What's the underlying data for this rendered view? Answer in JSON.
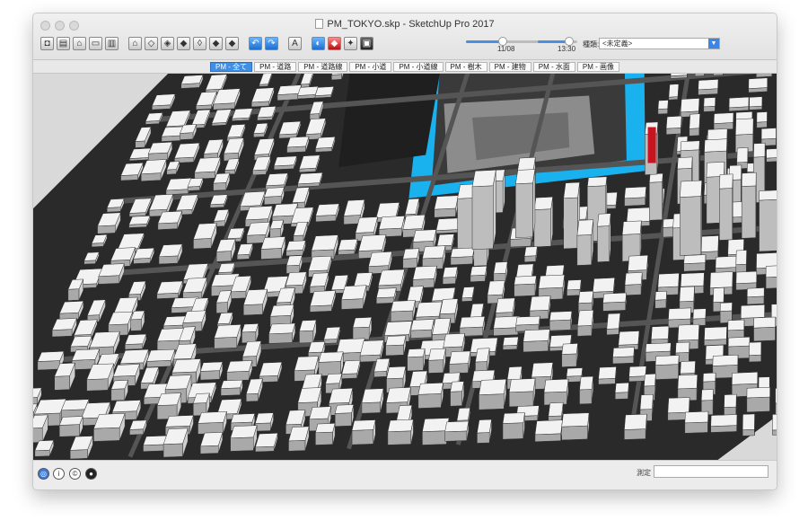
{
  "window": {
    "title": "PM_TOKYO.skp - SketchUp Pro 2017"
  },
  "toolbar": {
    "tools": [
      {
        "icon": "camera-icon",
        "glyph": "◘"
      },
      {
        "icon": "book-icon",
        "glyph": "▤"
      },
      {
        "icon": "home-icon",
        "glyph": "⌂"
      },
      {
        "icon": "save-icon",
        "glyph": "▭"
      },
      {
        "icon": "print-icon",
        "glyph": "▥"
      },
      {
        "icon": "house-view-icon",
        "glyph": "⌂"
      },
      {
        "icon": "iso-view-icon",
        "glyph": "◇"
      },
      {
        "icon": "top-view-icon",
        "glyph": "◈"
      },
      {
        "icon": "front-view-icon",
        "glyph": "◆"
      },
      {
        "icon": "right-view-icon",
        "glyph": "◊"
      },
      {
        "icon": "back-view-icon",
        "glyph": "◆"
      },
      {
        "icon": "left-view-icon",
        "glyph": "◆"
      },
      {
        "icon": "undo-icon",
        "glyph": "↶"
      },
      {
        "icon": "redo-icon",
        "glyph": "↷"
      },
      {
        "icon": "text-icon",
        "glyph": "A"
      },
      {
        "icon": "shadow-icon",
        "glyph": "◐"
      },
      {
        "icon": "ruby-icon",
        "glyph": "◆"
      },
      {
        "icon": "extension-icon",
        "glyph": "✦"
      },
      {
        "icon": "layout-icon",
        "glyph": "▣"
      }
    ],
    "date_label": "11/08",
    "date_fraction": 0.45,
    "time_label": "13:30",
    "time_fraction": 0.8,
    "scene_label": "種類:",
    "scene_value": "<未定義>"
  },
  "scene_tabs": [
    {
      "label": "PM - 全て",
      "active": true
    },
    {
      "label": "PM - 道路",
      "active": false
    },
    {
      "label": "PM - 道路線",
      "active": false
    },
    {
      "label": "PM - 小道",
      "active": false
    },
    {
      "label": "PM - 小道線",
      "active": false
    },
    {
      "label": "PM - 樹木",
      "active": false
    },
    {
      "label": "PM - 建物",
      "active": false
    },
    {
      "label": "PM - 水面",
      "active": false
    },
    {
      "label": "PM - 画像",
      "active": false
    }
  ],
  "statusbar": {
    "measure_label": "測定",
    "measure_value": ""
  },
  "colors": {
    "water": "#1ab2ee",
    "highlight_building": "#c8141e",
    "active_tab": "#3f8fe6"
  }
}
